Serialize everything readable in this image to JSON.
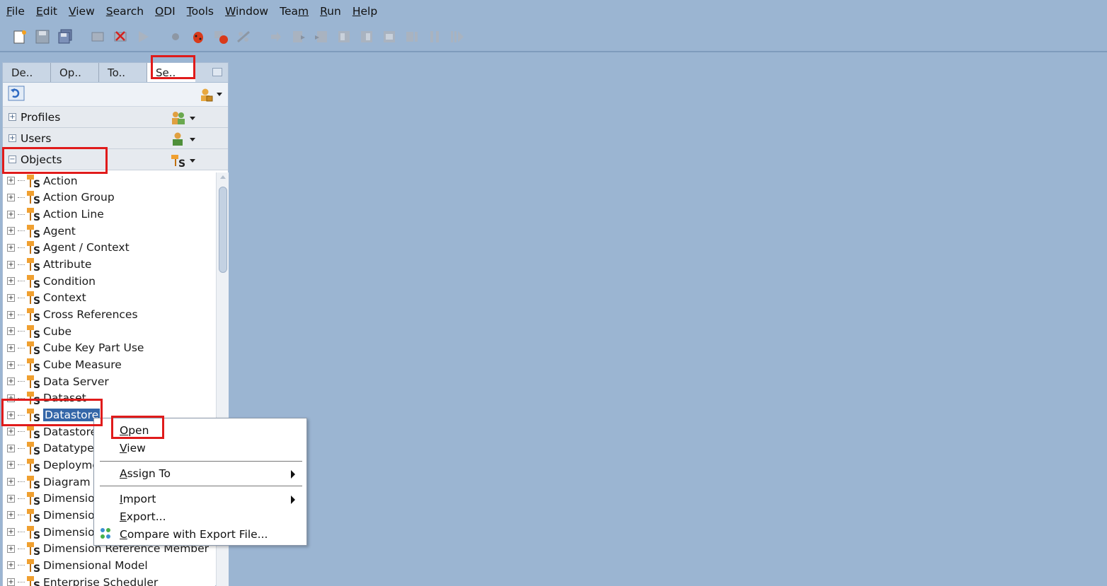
{
  "menubar": {
    "items": [
      {
        "label": "File",
        "mnemonic_index": 0
      },
      {
        "label": "Edit",
        "mnemonic_index": 0
      },
      {
        "label": "View",
        "mnemonic_index": 0
      },
      {
        "label": "Search",
        "mnemonic_index": 0
      },
      {
        "label": "ODI",
        "mnemonic_index": 0
      },
      {
        "label": "Tools",
        "mnemonic_index": 0
      },
      {
        "label": "Window",
        "mnemonic_index": 0
      },
      {
        "label": "Team",
        "mnemonic_index": 3
      },
      {
        "label": "Run",
        "mnemonic_index": 0
      },
      {
        "label": "Help",
        "mnemonic_index": 0
      }
    ]
  },
  "toolbar": {
    "icons": [
      "new-icon",
      "save-icon",
      "save-all-icon",
      "separator",
      "compile-icon",
      "compile-error-icon",
      "run-icon",
      "separator",
      "breakpoint-icon",
      "debug-icon",
      "debug-session-icon",
      "disable-breakpoint-icon",
      "separator",
      "step-into-icon",
      "step-over-icon",
      "step-out-icon",
      "step-back-icon",
      "step-forward-icon",
      "go-to-icon",
      "pause-icon",
      "resume-icon"
    ]
  },
  "panel": {
    "tabs": [
      {
        "label": "De.."
      },
      {
        "label": "Op.."
      },
      {
        "label": "To.."
      },
      {
        "label": "Se..",
        "active": true
      }
    ],
    "accordions": [
      {
        "label": "Profiles",
        "toggle": "+"
      },
      {
        "label": "Users",
        "toggle": "+"
      },
      {
        "label": "Objects",
        "toggle": "−"
      }
    ],
    "tree_items": [
      {
        "label": "Action"
      },
      {
        "label": "Action Group"
      },
      {
        "label": "Action Line"
      },
      {
        "label": "Agent"
      },
      {
        "label": "Agent / Context"
      },
      {
        "label": "Attribute"
      },
      {
        "label": "Condition"
      },
      {
        "label": "Context"
      },
      {
        "label": "Cross References"
      },
      {
        "label": "Cube"
      },
      {
        "label": "Cube Key Part Use"
      },
      {
        "label": "Cube Measure"
      },
      {
        "label": "Data Server"
      },
      {
        "label": "Dataset"
      },
      {
        "label": "Datastore",
        "selected": true
      },
      {
        "label": "Datastore"
      },
      {
        "label": "Datatype"
      },
      {
        "label": "Deployme"
      },
      {
        "label": "Diagram"
      },
      {
        "label": "Dimensio"
      },
      {
        "label": "Dimensio"
      },
      {
        "label": "Dimensio"
      },
      {
        "label": "Dimension Reference Member"
      },
      {
        "label": "Dimensional Model"
      },
      {
        "label": "Enterprise Scheduler"
      }
    ]
  },
  "context_menu": {
    "items": [
      {
        "label": "Open",
        "mnemonic_index": 0
      },
      {
        "label": "View",
        "mnemonic_index": 0
      },
      {
        "label": "Assign To",
        "mnemonic_index": 0,
        "submenu": true
      },
      {
        "label": "Import",
        "mnemonic_index": 0,
        "submenu": true
      },
      {
        "label": "Export...",
        "mnemonic_index": 0
      },
      {
        "label": "Compare with Export File...",
        "mnemonic_index": 0
      }
    ]
  },
  "colors": {
    "workspace_bg": "#9bb5d2",
    "highlight_red": "#e01b1b",
    "selection_blue": "#3466a8",
    "object_icon_orange": "#f0a030"
  }
}
